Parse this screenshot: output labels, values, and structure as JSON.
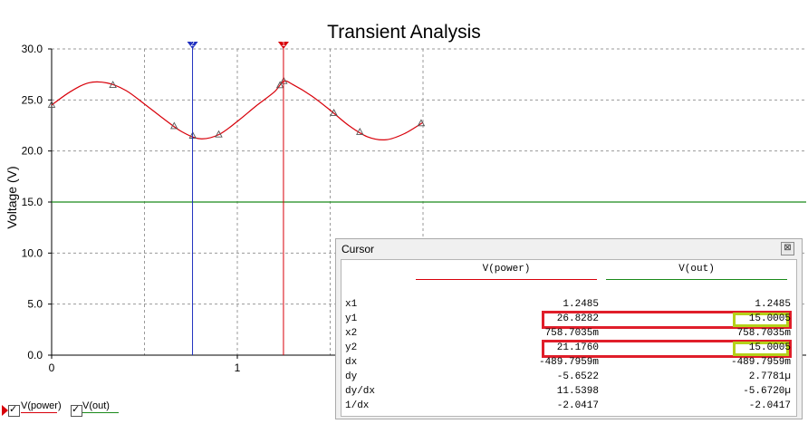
{
  "chart_data": {
    "type": "line",
    "title": "Transient Analysis",
    "ylabel": "Voltage (V)",
    "xlabel": "",
    "xlim": [
      0,
      2.0
    ],
    "ylim": [
      0,
      30
    ],
    "x_ticks": [
      "0",
      "1"
    ],
    "y_ticks": [
      "0.0",
      "5.0",
      "10.0",
      "15.0",
      "20.0",
      "25.0",
      "30.0"
    ],
    "grid": true,
    "series": [
      {
        "name": "V(power)",
        "color": "#d8000a",
        "points": [
          [
            0.0,
            24.5
          ],
          [
            0.1,
            25.8
          ],
          [
            0.2,
            26.68
          ],
          [
            0.3,
            26.66
          ],
          [
            0.4,
            25.93
          ],
          [
            0.5,
            24.6
          ],
          [
            0.6,
            23.2
          ],
          [
            0.7,
            21.9
          ],
          [
            0.8,
            21.2
          ],
          [
            0.9,
            21.6
          ],
          [
            1.0,
            22.9
          ],
          [
            1.1,
            24.4
          ],
          [
            1.2,
            25.8
          ],
          [
            1.25,
            26.83
          ],
          [
            1.3,
            26.5
          ],
          [
            1.4,
            25.4
          ],
          [
            1.5,
            24.0
          ],
          [
            1.6,
            22.5
          ],
          [
            1.7,
            21.4
          ],
          [
            1.8,
            21.1
          ],
          [
            1.9,
            21.7
          ],
          [
            2.0,
            22.8
          ]
        ],
        "markers_x": [
          0.0,
          0.33,
          0.66,
          0.76,
          0.9,
          1.23,
          1.25,
          1.52,
          1.66,
          1.99
        ]
      },
      {
        "name": "V(out)",
        "color": "#1a8a1a",
        "points": [
          [
            0.0,
            15.0
          ],
          [
            2.0,
            15.0
          ]
        ]
      }
    ],
    "cursors": [
      {
        "label": "1",
        "color": "#d8000a",
        "x": 1.2485
      },
      {
        "label": "2",
        "color": "#1f2fbf",
        "x": 0.7587
      }
    ]
  },
  "legend": {
    "items": [
      {
        "label": "V(power)",
        "color": "#d8000a"
      },
      {
        "label": "V(out)",
        "color": "#1a8a1a"
      }
    ]
  },
  "cursor_window": {
    "title": "Cursor",
    "close_glyph": "⊠",
    "headers": [
      "V(power)",
      "V(out)"
    ],
    "rows": [
      {
        "label": "x1",
        "v1": "1.2485",
        "v2": "1.2485"
      },
      {
        "label": "y1",
        "v1": "26.8282",
        "v2": "15.0005"
      },
      {
        "label": "x2",
        "v1": "758.7035m",
        "v2": "758.7035m"
      },
      {
        "label": "y2",
        "v1": "21.1760",
        "v2": "15.0005"
      },
      {
        "label": "dx",
        "v1": "-489.7959m",
        "v2": "-489.7959m"
      },
      {
        "label": "dy",
        "v1": "-5.6522",
        "v2": "2.7781µ"
      },
      {
        "label": "dy/dx",
        "v1": "11.5398",
        "v2": "-5.6720µ"
      },
      {
        "label": "1/dx",
        "v1": "-2.0417",
        "v2": "-2.0417"
      }
    ]
  }
}
